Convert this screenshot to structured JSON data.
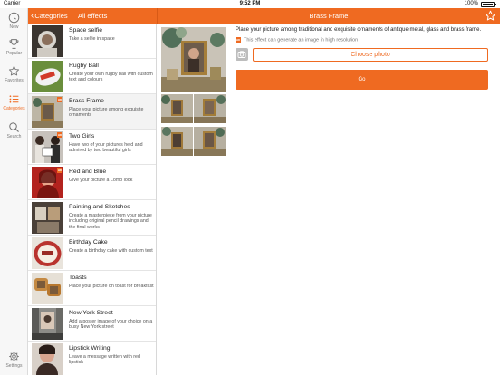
{
  "status_bar": {
    "carrier": "Carrier",
    "time": "9:52 PM",
    "battery": "100%"
  },
  "rail": {
    "items": [
      {
        "label": "New",
        "icon": "clock-icon"
      },
      {
        "label": "Popular",
        "icon": "trophy-icon"
      },
      {
        "label": "Favorites",
        "icon": "star-icon"
      },
      {
        "label": "Categories",
        "icon": "list-icon",
        "active": true
      },
      {
        "label": "Search",
        "icon": "search-icon"
      }
    ],
    "settings_label": "Settings"
  },
  "header": {
    "back_label": "Categories",
    "list_title": "All effects",
    "detail_title": "Brass Frame"
  },
  "effects": [
    {
      "title": "Space selfie",
      "subtitle": "Take a selfie in space",
      "hd": false
    },
    {
      "title": "Rugby Ball",
      "subtitle": "Create your own rugby ball with custom text and colours",
      "hd": false
    },
    {
      "title": "Brass Frame",
      "subtitle": "Place your picture among exquisite ornaments",
      "hd": true,
      "selected": true
    },
    {
      "title": "Two Girls",
      "subtitle": "Have two of your pictures held and admired by two beautiful girls",
      "hd": true
    },
    {
      "title": "Red and Blue",
      "subtitle": "Give your picture a Lomo look",
      "hd": true
    },
    {
      "title": "Painting and Sketches",
      "subtitle": "Create a masterpiece from your picture including original pencil drawings and the final works",
      "hd": false
    },
    {
      "title": "Birthday Cake",
      "subtitle": "Create a birthday cake with custom text",
      "hd": false
    },
    {
      "title": "Toasts",
      "subtitle": "Place your picture on toast for breakfast",
      "hd": false
    },
    {
      "title": "New York Street",
      "subtitle": "Add a poster image of your choice on a busy New York street",
      "hd": false
    },
    {
      "title": "Lipstick Writing",
      "subtitle": "Leave a message written with red lipstick",
      "hd": false
    }
  ],
  "detail": {
    "description": "Place your picture among traditional and exquisite ornaments of antique metal, glass and brass frame.",
    "hd_badge": "HD",
    "hd_note": "This effect can generate an image in high resolution",
    "choose_photo": "Choose photo",
    "go": "Go"
  },
  "colors": {
    "accent": "#ef6a21"
  }
}
